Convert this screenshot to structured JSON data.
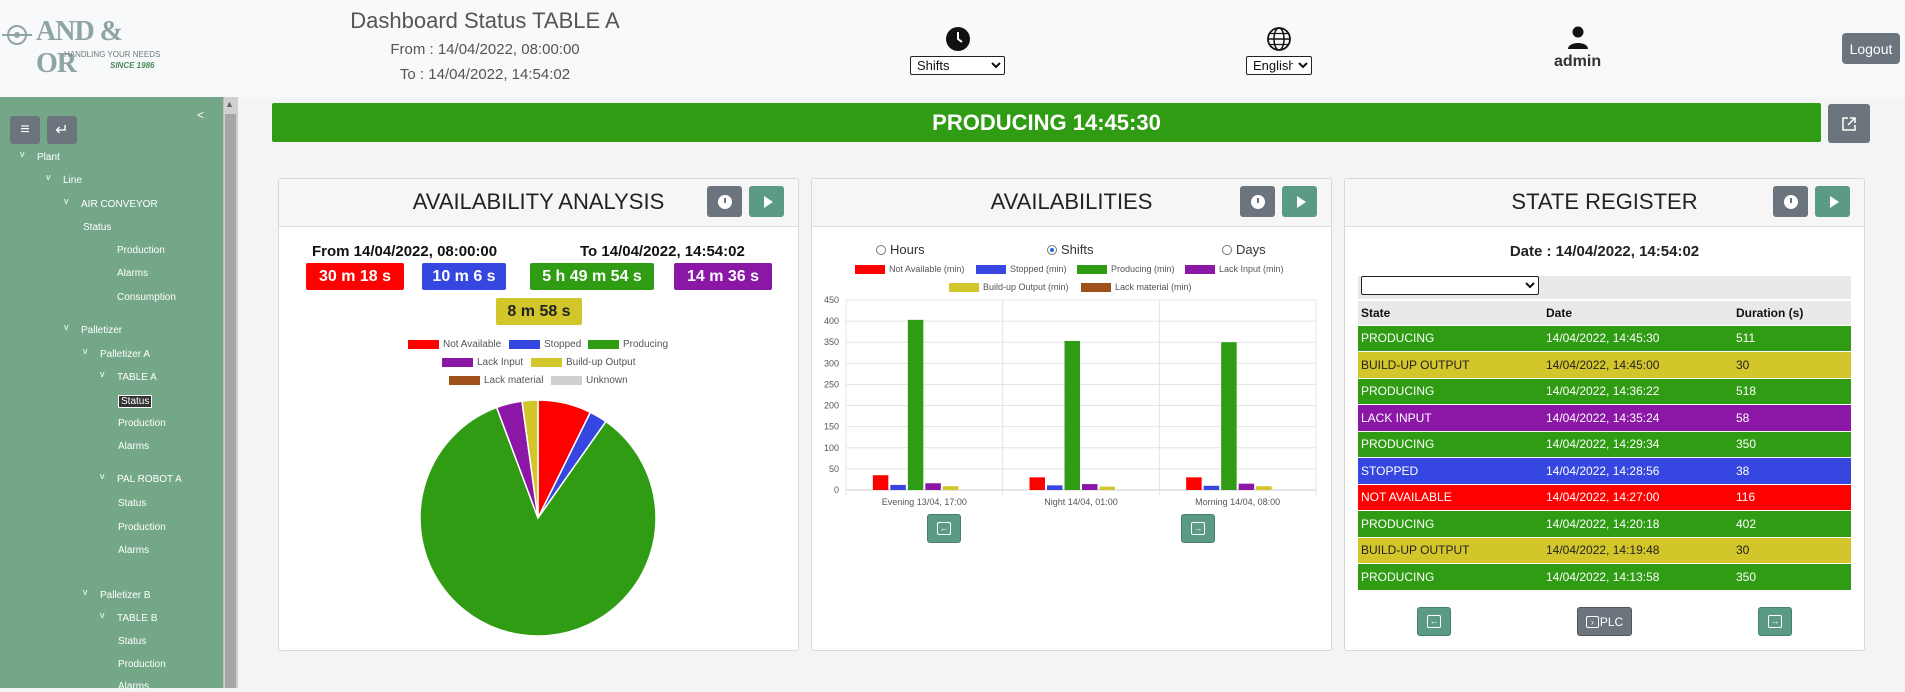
{
  "header": {
    "logo_text": "AND & OR",
    "logo_tagline": "HANDLING YOUR NEEDS",
    "logo_since": "SINCE 1986",
    "title": "Dashboard Status TABLE A",
    "from": "From : 14/04/2022, 08:00:00",
    "to": "To : 14/04/2022, 14:54:02",
    "period_select": "Shifts",
    "language_select": "English",
    "user": "admin",
    "logout_label": "Logout"
  },
  "sidebar": {
    "collapse_glyph": "<",
    "menu_icon": "menu-icon",
    "back_icon": "back-icon",
    "tree": {
      "plant": "Plant",
      "line": "Line",
      "air_conveyor": "AIR CONVEYOR",
      "air_status": "Status",
      "air_production": "Production",
      "air_alarms": "Alarms",
      "air_consumption": "Consumption",
      "palletizer": "Palletizer",
      "palletizer_a": "Palletizer A",
      "table_a": "TABLE A",
      "table_a_status": "Status",
      "table_a_production": "Production",
      "table_a_alarms": "Alarms",
      "pal_robot_a": "PAL ROBOT A",
      "robot_status": "Status",
      "robot_production": "Production",
      "robot_alarms": "Alarms",
      "palletizer_b": "Palletizer B",
      "table_b": "TABLE B",
      "table_b_status": "Status",
      "table_b_production": "Production",
      "table_b_alarms": "Alarms",
      "chevron": "v"
    }
  },
  "status_bar": {
    "text": "PRODUCING 14:45:30",
    "color": "#2f9c13"
  },
  "colors": {
    "not_available": "#ff0000",
    "stopped": "#3547e0",
    "producing": "#2f9c13",
    "lack_input": "#8c16a6",
    "buildup_output": "#d2c62a",
    "lack_material": "#a0501a",
    "unknown": "#cfcfcf"
  },
  "availability_analysis": {
    "title": "AVAILABILITY ANALYSIS",
    "from": "From 14/04/2022, 08:00:00",
    "to": "To 14/04/2022, 14:54:02",
    "pills": [
      {
        "label": "30 m 18 s",
        "color": "#ff0000"
      },
      {
        "label": "10 m 6 s",
        "color": "#3547e0"
      },
      {
        "label": "5 h 49 m 54 s",
        "color": "#2f9c13"
      },
      {
        "label": "14 m 36 s",
        "color": "#8c16a6"
      },
      {
        "label": "8 m 58 s",
        "color": "#d2c62a"
      }
    ],
    "legend": [
      "Not Available",
      "Stopped",
      "Producing",
      "Lack Input",
      "Build-up Output",
      "Lack material",
      "Unknown"
    ]
  },
  "availabilities": {
    "title": "AVAILABILITIES",
    "radios": [
      {
        "label": "Hours",
        "checked": false
      },
      {
        "label": "Shifts",
        "checked": true
      },
      {
        "label": "Days",
        "checked": false
      }
    ],
    "legend": [
      "Not Available (min)",
      "Stopped (min)",
      "Producing (min)",
      "Lack Input (min)",
      "Build-up Output (min)",
      "Lack material (min)"
    ]
  },
  "state_register": {
    "title": "STATE REGISTER",
    "date": "Date : 14/04/2022, 14:54:02",
    "filter_value": "",
    "columns": [
      "State",
      "Date",
      "Duration (s)"
    ],
    "rows": [
      {
        "state": "PRODUCING",
        "date": "14/04/2022, 14:45:30",
        "duration": "511",
        "color": "#2f9c13",
        "text": "#ffffff"
      },
      {
        "state": "BUILD-UP OUTPUT",
        "date": "14/04/2022, 14:45:00",
        "duration": "30",
        "color": "#d2c62a",
        "text": "#222222"
      },
      {
        "state": "PRODUCING",
        "date": "14/04/2022, 14:36:22",
        "duration": "518",
        "color": "#2f9c13",
        "text": "#ffffff"
      },
      {
        "state": "LACK INPUT",
        "date": "14/04/2022, 14:35:24",
        "duration": "58",
        "color": "#8c16a6",
        "text": "#ffffff"
      },
      {
        "state": "PRODUCING",
        "date": "14/04/2022, 14:29:34",
        "duration": "350",
        "color": "#2f9c13",
        "text": "#ffffff"
      },
      {
        "state": "STOPPED",
        "date": "14/04/2022, 14:28:56",
        "duration": "38",
        "color": "#3547e0",
        "text": "#ffffff"
      },
      {
        "state": "NOT AVAILABLE",
        "date": "14/04/2022, 14:27:00",
        "duration": "116",
        "color": "#ff0000",
        "text": "#ffffff"
      },
      {
        "state": "PRODUCING",
        "date": "14/04/2022, 14:20:18",
        "duration": "402",
        "color": "#2f9c13",
        "text": "#ffffff"
      },
      {
        "state": "BUILD-UP OUTPUT",
        "date": "14/04/2022, 14:19:48",
        "duration": "30",
        "color": "#d2c62a",
        "text": "#222222"
      },
      {
        "state": "PRODUCING",
        "date": "14/04/2022, 14:13:58",
        "duration": "350",
        "color": "#2f9c13",
        "text": "#ffffff"
      }
    ],
    "plc_label": "PLC"
  },
  "chart_data": [
    {
      "type": "pie",
      "categories": [
        "Not Available",
        "Stopped",
        "Producing",
        "Lack Input",
        "Build-up Output",
        "Lack material",
        "Unknown"
      ],
      "values": [
        30.3,
        10.1,
        349.9,
        14.6,
        8.97,
        0,
        0
      ],
      "colors": [
        "#ff0000",
        "#3547e0",
        "#2f9c13",
        "#8c16a6",
        "#d2c62a",
        "#a0501a",
        "#cfcfcf"
      ],
      "legend_position": "top"
    },
    {
      "type": "bar",
      "categories": [
        "Evening  13/04, 17:00",
        "Night  14/04, 01:00",
        "Morning  14/04, 08:00"
      ],
      "series": [
        {
          "name": "Not Available (min)",
          "color": "#ff0000",
          "values": [
            35,
            30,
            30
          ]
        },
        {
          "name": "Stopped (min)",
          "color": "#3547e0",
          "values": [
            12,
            11,
            10
          ]
        },
        {
          "name": "Producing (min)",
          "color": "#2f9c13",
          "values": [
            403,
            353,
            350
          ]
        },
        {
          "name": "Lack Input (min)",
          "color": "#8c16a6",
          "values": [
            16,
            14,
            15
          ]
        },
        {
          "name": "Build-up Output (min)",
          "color": "#d2c62a",
          "values": [
            9,
            8,
            9
          ]
        },
        {
          "name": "Lack material (min)",
          "color": "#a0501a",
          "values": [
            0,
            0,
            0
          ]
        }
      ],
      "ylim": [
        0,
        450
      ],
      "yticks": [
        0,
        50,
        100,
        150,
        200,
        250,
        300,
        350,
        400,
        450
      ],
      "grid": true,
      "legend_position": "top"
    }
  ]
}
